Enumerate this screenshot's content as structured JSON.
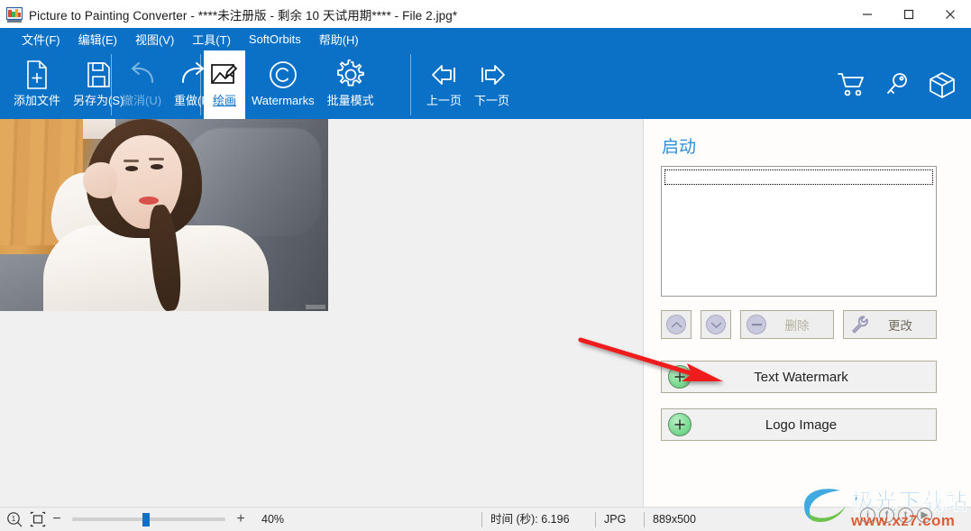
{
  "window": {
    "title": "Picture to Painting Converter - ****未注册版 - 剩余 10 天试用期**** - File 2.jpg*",
    "icon": "app-icon",
    "minimize_label": "–",
    "maximize_label": "□",
    "close_label": "✕"
  },
  "menu": {
    "items": [
      {
        "label": "文件(F)",
        "name": "menu-file"
      },
      {
        "label": "编辑(E)",
        "name": "menu-edit"
      },
      {
        "label": "视图(V)",
        "name": "menu-view"
      },
      {
        "label": "工具(T)",
        "name": "menu-tools"
      },
      {
        "label": "SoftOrbits",
        "name": "menu-softorbits"
      },
      {
        "label": "帮助(H)",
        "name": "menu-help"
      }
    ]
  },
  "toolbar": {
    "add_file": "添加文件",
    "save_as": "另存为(S)",
    "undo": "撤消(U)",
    "redo": "重做(R)",
    "draw": "绘画",
    "watermarks": "Watermarks",
    "batch_mode": "批量模式",
    "prev_page": "上一页",
    "next_page": "下一页",
    "cart_icon": "cart-icon",
    "key_icon": "key-icon",
    "box_icon": "box-icon",
    "active_tab": "绘画"
  },
  "panel": {
    "title": "启动",
    "list_items": [],
    "move_up": "",
    "move_down": "",
    "delete_label": "删除",
    "change_label": "更改",
    "text_watermark_label": "Text Watermark",
    "logo_image_label": "Logo Image"
  },
  "statusbar": {
    "zoom_icon": "zoom-1-to-1-icon",
    "fit_icon": "fit-to-window-icon",
    "minus": "−",
    "plus": "+",
    "zoom_value": "40%",
    "time_label": "时间 (秒): 6.196",
    "format": "JPG",
    "dimensions": "889x500"
  },
  "watermark_badge": {
    "text": "极光下载站",
    "url": "www.xz7.com"
  },
  "colors": {
    "accent": "#0a71c6",
    "panel_title": "#2f8fd8",
    "arrow": "#ee1c1c",
    "plus_green": "#7fdc95"
  }
}
